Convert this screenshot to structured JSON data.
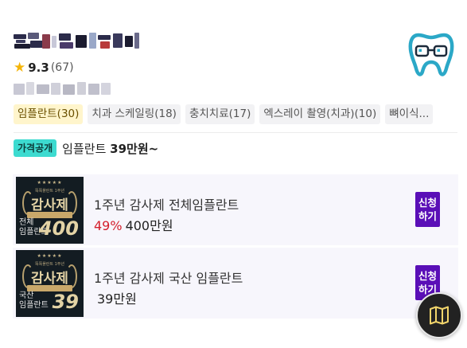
{
  "clinic": {
    "rating_score": "9.3",
    "rating_count": "(67)"
  },
  "tags": [
    {
      "label": "임플란트(30)",
      "active": true
    },
    {
      "label": "치과 스케일링(18)",
      "active": false
    },
    {
      "label": "충치치료(17)",
      "active": false
    },
    {
      "label": "엑스레이 촬영(치과)(10)",
      "active": false
    },
    {
      "label": "뼈이식...",
      "active": false
    }
  ],
  "price": {
    "badge": "가격공개",
    "text": "임플란트",
    "amount": "39만원~"
  },
  "products": [
    {
      "title": "1주년 감사제 전체임플란트",
      "discount": "49%",
      "price": "400만원",
      "apply": "신청하기",
      "thumb": {
        "top": "★★★★★",
        "sub": "똑똑플란트 1주년",
        "big": "감사제",
        "label_line1": "전체",
        "label_line2": "임플란트",
        "number": "400"
      }
    },
    {
      "title": "1주년 감사제 국산 임플란트",
      "discount": "",
      "price": "39만원",
      "apply": "신청하기",
      "thumb": {
        "top": "★★★★★",
        "sub": "똑똑플란트 1주년",
        "big": "감사제",
        "label_line1": "국산",
        "label_line2": "임플란트",
        "number": "39"
      }
    }
  ],
  "colors": {
    "star": "#f5b50a",
    "tag_active_bg": "#fff5cc",
    "price_badge_bg": "#3ddbd0",
    "discount": "#d41e2b",
    "apply_button": "#5a0fb7",
    "map_button": "#222222",
    "logo_teal": "#2ba8c7"
  },
  "icons": {
    "rating": "star-icon",
    "logo": "tooth-logo-icon",
    "map": "map-icon"
  }
}
